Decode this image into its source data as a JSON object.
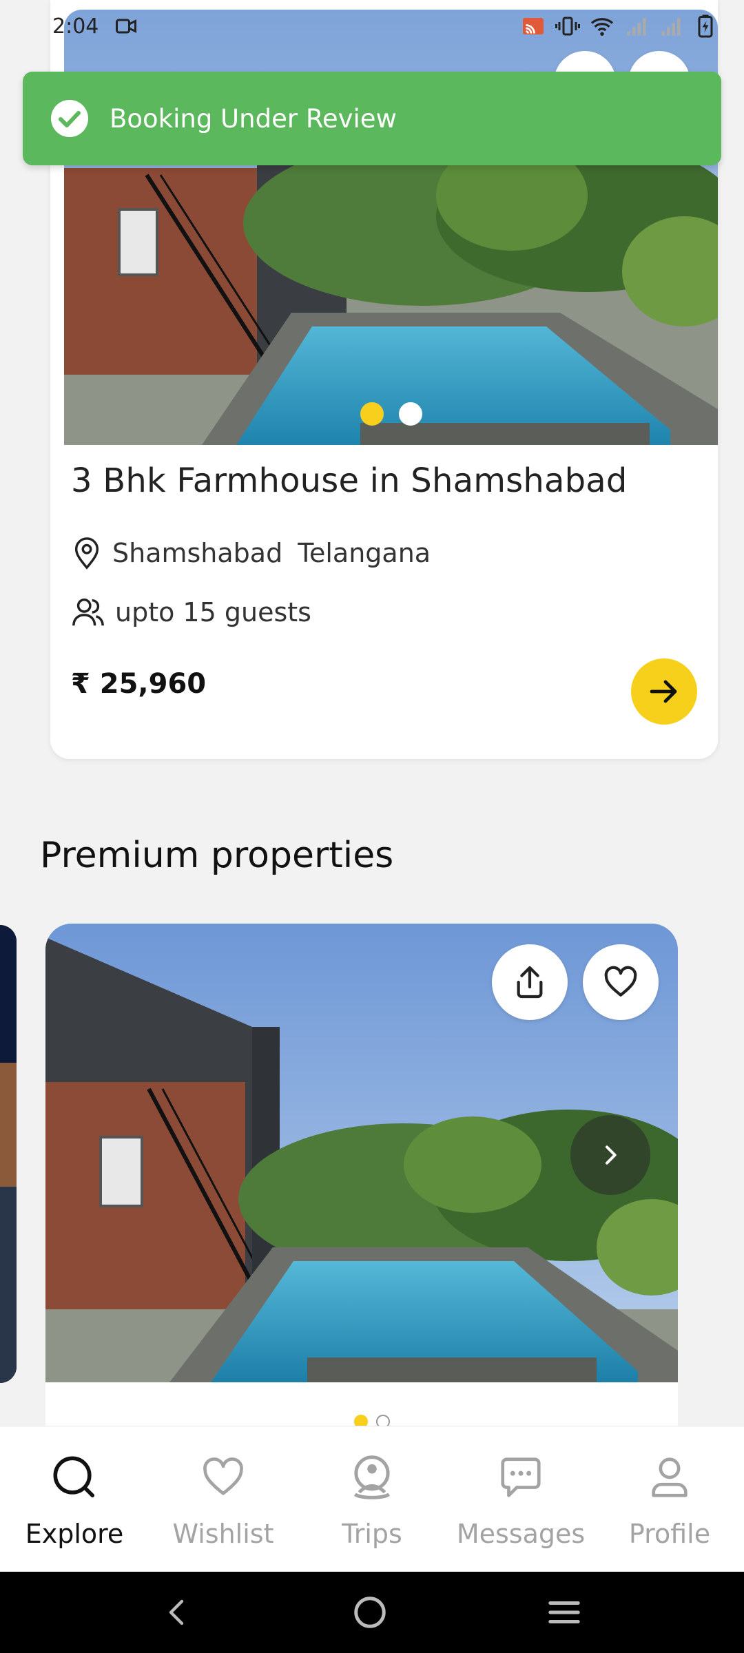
{
  "status_bar": {
    "time": "2:04",
    "icons": [
      "video-icon",
      "cast-icon",
      "vibrate-icon",
      "wifi-icon",
      "signal-icon",
      "signal-icon",
      "battery-icon"
    ]
  },
  "toast": {
    "message": "Booking Under Review",
    "icon": "check-circle-icon",
    "color": "#5cb85c"
  },
  "listing": {
    "title": "3 Bhk Farmhouse in Shamshabad",
    "city": "Shamshabad",
    "state": "Telangana",
    "guests": "upto 15 guests",
    "price": "₹ 25,960",
    "image_count": 2,
    "active_image": 1
  },
  "premium": {
    "section_title": "Premium properties",
    "image_count": 2,
    "active_image": 1
  },
  "bottom_nav": [
    {
      "label": "Explore",
      "icon": "search-icon",
      "active": true
    },
    {
      "label": "Wishlist",
      "icon": "heart-icon",
      "active": false
    },
    {
      "label": "Trips",
      "icon": "trips-icon",
      "active": false
    },
    {
      "label": "Messages",
      "icon": "chat-icon",
      "active": false
    },
    {
      "label": "Profile",
      "icon": "profile-icon",
      "active": false
    }
  ],
  "accent_color": "#f7d01b"
}
